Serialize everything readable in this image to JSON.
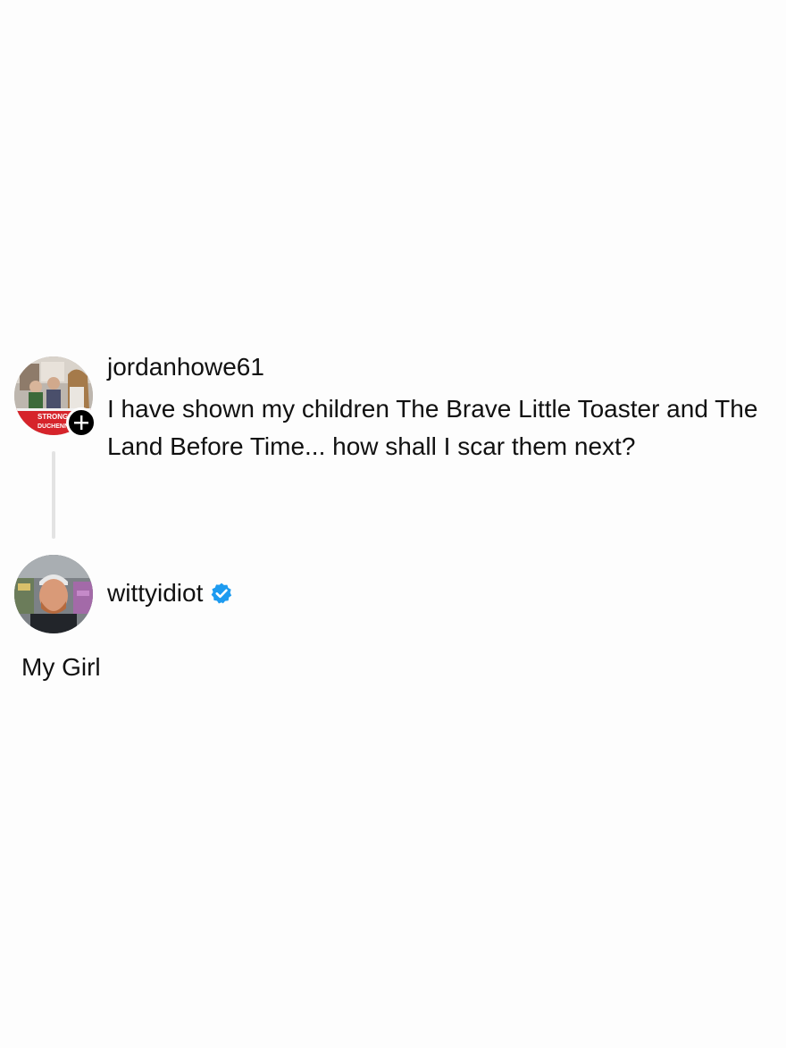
{
  "post1": {
    "username": "jordanhowe61",
    "text": "I have shown my children The Brave Little Toaster and The Land Before Time... how shall I scar them next?",
    "avatar_icon": "user-avatar-photo",
    "avatar_banner_line1": "STRONGER",
    "avatar_banner_line2": "DUCHENNE",
    "follow_icon": "plus-icon"
  },
  "post2": {
    "username": "wittyidiot",
    "verified_icon": "verified-badge-icon",
    "avatar_icon": "user-avatar-photo",
    "text": "My Girl"
  },
  "colors": {
    "background": "#fdfdfd",
    "text": "#111111",
    "verified": "#1d9bf0",
    "thread_line": "#e3e3e3",
    "follow_badge": "#000000"
  }
}
